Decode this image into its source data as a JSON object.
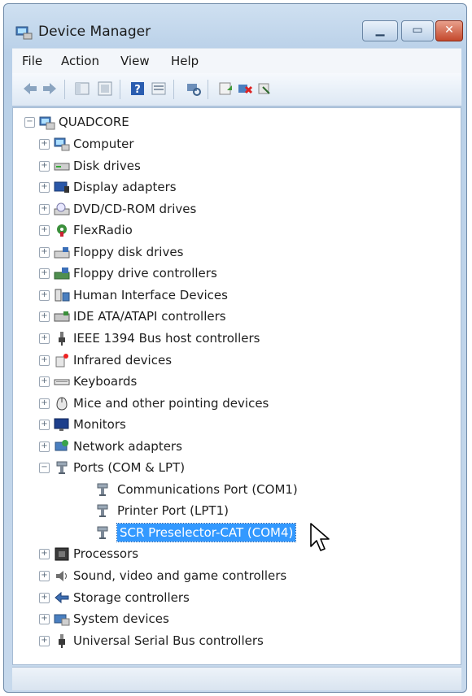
{
  "window": {
    "title": "Device Manager"
  },
  "menu": [
    "File",
    "Action",
    "View",
    "Help"
  ],
  "tree": {
    "root": "QUADCORE",
    "categories": [
      {
        "label": "Computer",
        "icon": "computer-icon"
      },
      {
        "label": "Disk drives",
        "icon": "disk-drive-icon"
      },
      {
        "label": "Display adapters",
        "icon": "display-adapter-icon"
      },
      {
        "label": "DVD/CD-ROM drives",
        "icon": "dvd-drive-icon"
      },
      {
        "label": "FlexRadio",
        "icon": "radio-icon"
      },
      {
        "label": "Floppy disk drives",
        "icon": "floppy-drive-icon"
      },
      {
        "label": "Floppy drive controllers",
        "icon": "floppy-controller-icon"
      },
      {
        "label": "Human Interface Devices",
        "icon": "hid-icon"
      },
      {
        "label": "IDE ATA/ATAPI controllers",
        "icon": "ide-controller-icon"
      },
      {
        "label": "IEEE 1394 Bus host controllers",
        "icon": "firewire-icon"
      },
      {
        "label": "Infrared devices",
        "icon": "infrared-icon"
      },
      {
        "label": "Keyboards",
        "icon": "keyboard-icon"
      },
      {
        "label": "Mice and other pointing devices",
        "icon": "mouse-icon"
      },
      {
        "label": "Monitors",
        "icon": "monitor-icon"
      },
      {
        "label": "Network adapters",
        "icon": "network-adapter-icon"
      },
      {
        "label": "Ports (COM & LPT)",
        "icon": "port-icon",
        "expanded": true
      },
      {
        "label": "Processors",
        "icon": "processor-icon"
      },
      {
        "label": "Sound, video and game controllers",
        "icon": "sound-icon"
      },
      {
        "label": "Storage controllers",
        "icon": "storage-controller-icon"
      },
      {
        "label": "System devices",
        "icon": "system-device-icon"
      },
      {
        "label": "Universal Serial Bus controllers",
        "icon": "usb-icon"
      }
    ],
    "ports_children": [
      {
        "label": "Communications Port (COM1)",
        "icon": "port-icon"
      },
      {
        "label": "Printer Port (LPT1)",
        "icon": "port-icon"
      },
      {
        "label": "SCR Preselector-CAT (COM4)",
        "icon": "port-icon",
        "selected": true
      }
    ]
  },
  "colors": {
    "selection": "#3399ff",
    "title_bar": "#bcd1e8",
    "close_button": "#c4482c"
  }
}
